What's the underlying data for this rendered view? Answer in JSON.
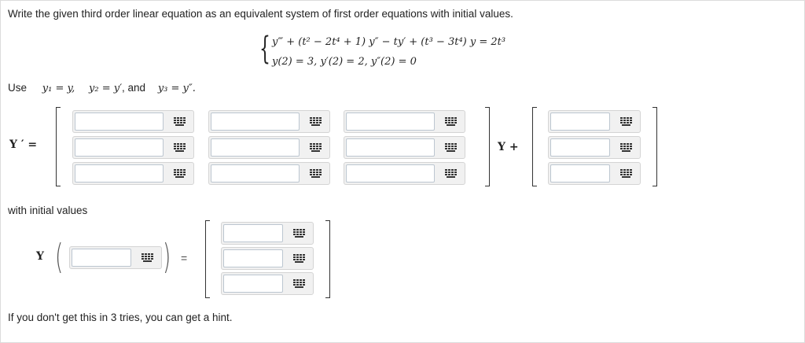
{
  "prompt": "Write the given third order linear equation as an equivalent system of first order equations with initial values.",
  "equation": {
    "line1": "y‴ + (t² − 2t⁴ + 1) y″ − ty′ + (t³ − 3t⁴) y = 2t³",
    "line2": "y(2) = 3,   y′(2) = 2,   y″(2) = 0"
  },
  "use_line": {
    "prefix": "Use",
    "y1": "y₁ = y,",
    "y2": "y₂ = y′",
    "and": ", and",
    "y3": "y₃ = y″."
  },
  "system": {
    "lhs_label": "Y ′ =",
    "times_label": "Y +"
  },
  "initial_values_label": "with initial values",
  "initial": {
    "y_label": "Y",
    "equals": "="
  },
  "hint": "If you don't get this in 3 tries, you can get a hint.",
  "icons": {
    "keyboard": "keyboard-grid-icon"
  }
}
